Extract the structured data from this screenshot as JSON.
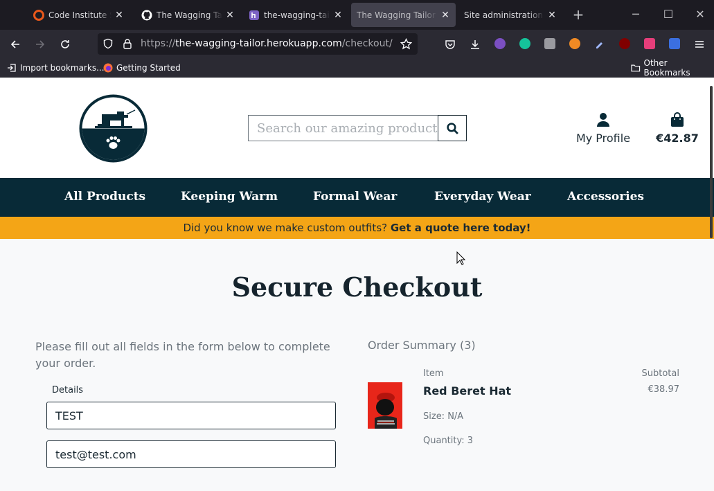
{
  "browser": {
    "tabs": [
      {
        "title": "Code Institute Sch",
        "favicon": "code-institute-icon",
        "favicon_color": "#e9581b",
        "active": false
      },
      {
        "title": "The Wagging Tailo",
        "favicon": "github-icon",
        "favicon_color": "#ffffff",
        "active": false
      },
      {
        "title": "the-wagging-tailo",
        "favicon": "heroku-icon",
        "favicon_color": "#7b61c4",
        "active": false
      },
      {
        "title": "The Wagging Tailor - S",
        "favicon": "none",
        "favicon_color": "",
        "active": true
      },
      {
        "title": "Site administration | Dj",
        "favicon": "none",
        "favicon_color": "",
        "active": false
      }
    ],
    "new_tab_label": "+",
    "url_protocol": "https://",
    "url_host": "the-wagging-tailor.herokuapp.com",
    "url_path": "/checkout/",
    "bookmarks": [
      {
        "label": "Import bookmarks...",
        "icon": "import-icon"
      },
      {
        "label": "Getting Started",
        "icon": "firefox-icon"
      }
    ],
    "other_bookmarks": "Other Bookmarks"
  },
  "site": {
    "search_placeholder": "Search our amazing products",
    "profile_label": "My Profile",
    "bag_total": "€42.87",
    "nav": [
      "All Products",
      "Keeping Warm",
      "Formal Wear",
      "Everyday Wear",
      "Accessories"
    ],
    "banner_text": "Did you know we make custom outfits?",
    "banner_link": "Get a quote here today!",
    "brand_color": "#082a37",
    "accent_color": "#f4a516"
  },
  "checkout": {
    "title": "Secure Checkout",
    "intro": "Please fill out all fields in the form below to complete your order.",
    "details_label": "Details",
    "name_value": "TEST",
    "email_value": "test@test.com",
    "summary_title": "Order Summary (3)",
    "col_item": "Item",
    "col_subtotal": "Subtotal",
    "item": {
      "name": "Red Beret Hat",
      "size": "Size: N/A",
      "quantity": "Quantity: 3",
      "subtotal": "€38.97"
    }
  }
}
